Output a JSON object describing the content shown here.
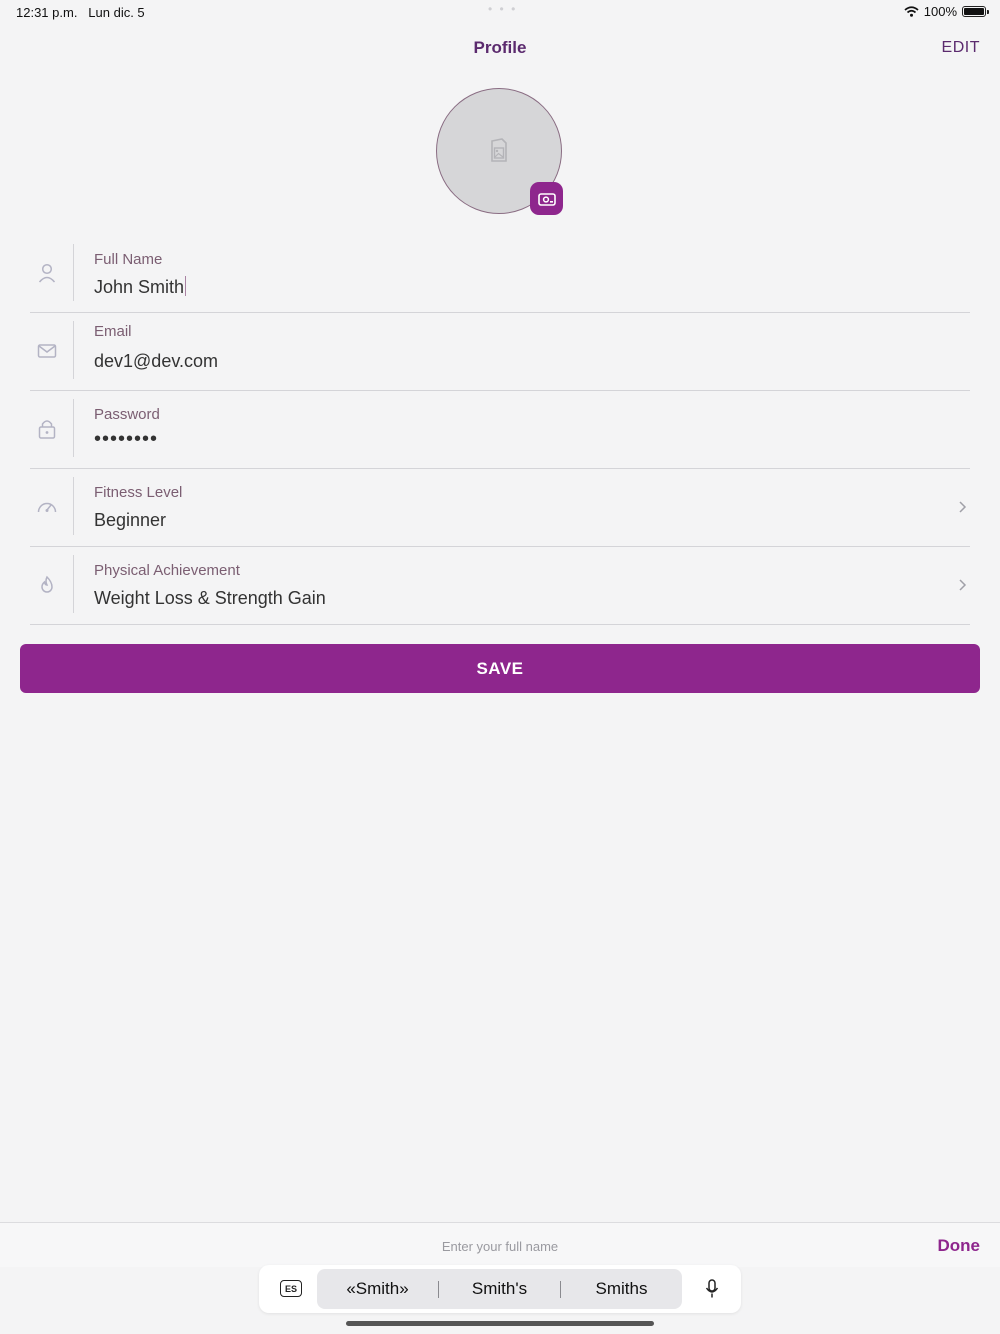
{
  "status_bar": {
    "time": "12:31 p.m.",
    "date": "Lun dic. 5",
    "battery": "100%",
    "dots": "• • •"
  },
  "header": {
    "title": "Profile",
    "edit_label": "EDIT"
  },
  "avatar": {
    "placeholder_icon": "image-placeholder-icon",
    "action_icon": "camera-icon"
  },
  "fields": [
    {
      "label": "Full Name",
      "value": "John Smith",
      "icon": "user-icon"
    },
    {
      "label": "Email",
      "value": "dev1@dev.com",
      "icon": "mail-icon"
    },
    {
      "label": "Password",
      "value": "••••••••",
      "icon": "lock-icon"
    },
    {
      "label": "Fitness Level",
      "value": "Beginner",
      "icon": "speedometer-icon"
    },
    {
      "label": "Physical Achievement",
      "value": "Weight Loss & Strength Gain",
      "icon": "flame-icon"
    }
  ],
  "save_label": "SAVE",
  "keyboard": {
    "placeholder": "Enter your full name",
    "done_label": "Done",
    "language": "ES",
    "suggestions": [
      "«Smith»",
      "Smith's",
      "Smiths"
    ]
  },
  "colors": {
    "accent": "#8e268d",
    "title": "#5b2a6e",
    "label": "#7b5e72",
    "background": "#f4f4f5"
  }
}
